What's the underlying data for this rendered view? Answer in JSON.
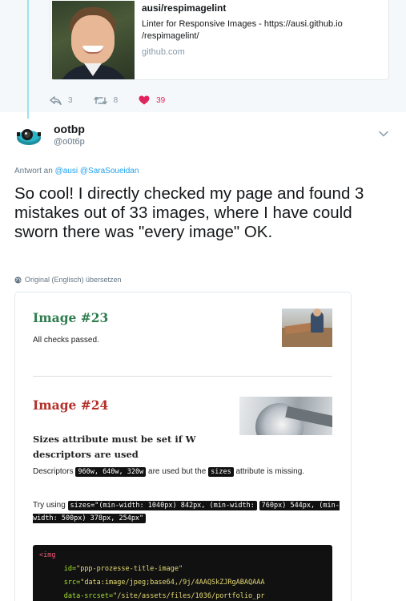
{
  "quoted_tweet": {
    "card": {
      "title": "ausi/respimagelint",
      "description": "Linter for Responsive Images - https://ausi.github.io /respimagelint/",
      "domain": "github.com"
    },
    "actions": {
      "replies": "3",
      "retweets": "8",
      "likes": "39"
    }
  },
  "tweet": {
    "display_name": "ootbp",
    "handle": "@o0t6p",
    "reply_to_prefix": "Antwort an",
    "reply_to_mentions": [
      "@ausi",
      "@SaraSoueidan"
    ],
    "text": "So cool! I directly checked my page and found 3 mistakes out of 33 images, where I have could sworn there was \"every image\" OK.",
    "translate_label": "Original (Englisch) übersetzen"
  },
  "screenshot": {
    "image23": {
      "title": "Image #23",
      "status": "All checks passed."
    },
    "image24": {
      "title": "Image #24",
      "error_title": "Sizes attribute must be set if W descriptors are used",
      "desc_prefix": "Descriptors",
      "descriptors_code": "960w, 640w, 320w",
      "desc_middle": "are used but the",
      "sizes_code": "sizes",
      "desc_suffix": "attribute is missing.",
      "try_prefix": "Try using",
      "suggestion_code_1": "sizes=\"(min-width: 1040px) 842px, (min-width:",
      "suggestion_code_2": "760px) 544px, (min-width: 500px) 378px, 254px\""
    },
    "code": {
      "tag_open": "<img",
      "line1_attr": "id=",
      "line1_val": "\"ppp-prozesse-title-image\"",
      "line2_attr": "src=",
      "line2_val": "\"data:image/jpeg;base64,/9j/4AAQSkZJRgABAQAAA",
      "line3_attr": "data-srcset=",
      "line3_val": "\"/site/assets/files/1036/portfolio_pr"
    }
  },
  "colors": {
    "link": "#1da1f2",
    "like": "#e0245e",
    "pass_heading": "#2e7d4f",
    "fail_heading": "#b5302a"
  },
  "icons": [
    "reply-icon",
    "retweet-icon",
    "heart-icon",
    "chevron-down-icon",
    "globe-icon"
  ]
}
